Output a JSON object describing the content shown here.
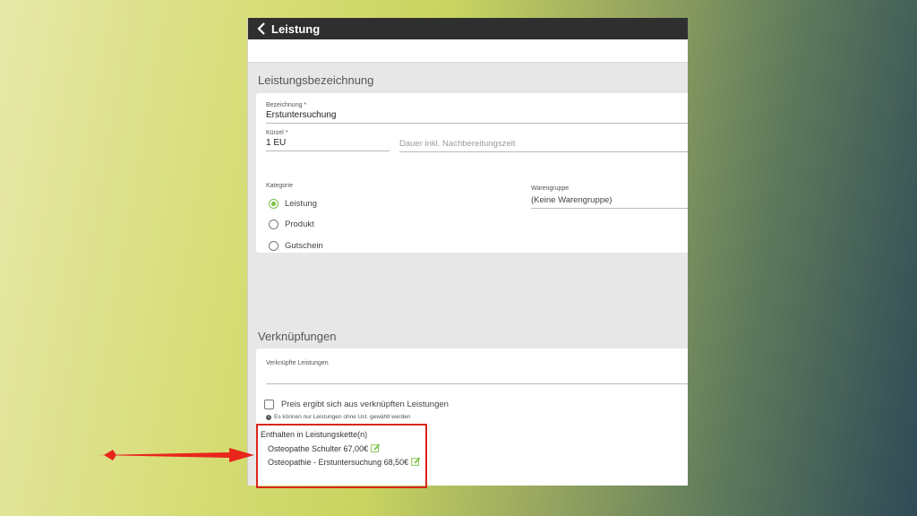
{
  "header": {
    "title": "Leistung"
  },
  "leistungsbezeichnung": {
    "section_title": "Leistungsbezeichnung",
    "bezeichnung_label": "Bezeichnung *",
    "bezeichnung_value": "Erstuntersuchung",
    "kuerzel_label": "Kürzel *",
    "kuerzel_value": "1 EU",
    "dauer_placeholder": "Dauer inkl. Nachbereitungszeit",
    "kategorie_label": "Kategorie",
    "kategorie_options": [
      {
        "label": "Leistung",
        "checked": true
      },
      {
        "label": "Produkt",
        "checked": false
      },
      {
        "label": "Gutschein",
        "checked": false
      }
    ],
    "warengruppe_label": "Warengruppe",
    "warengruppe_value": "(Keine Warengruppe)"
  },
  "verknuepfungen": {
    "section_title": "Verknüpfungen",
    "verknuepfte_label": "Verknüpfte Leistungen",
    "preis_checkbox_label": "Preis ergibt sich aus verknüpften Leistungen",
    "info_text": "Es können nur Leistungen ohne Ust. gewählt werden",
    "chain_title": "Enthalten in Leistungskette(n)",
    "chain_items": [
      "Osteopathe Schulter 67,00€",
      "Osteopathie - Erstuntersuchung 68,50€"
    ]
  },
  "colors": {
    "accent_green": "#7ac142",
    "highlight_red": "#d9261c",
    "topbar": "#2f2f2f"
  }
}
